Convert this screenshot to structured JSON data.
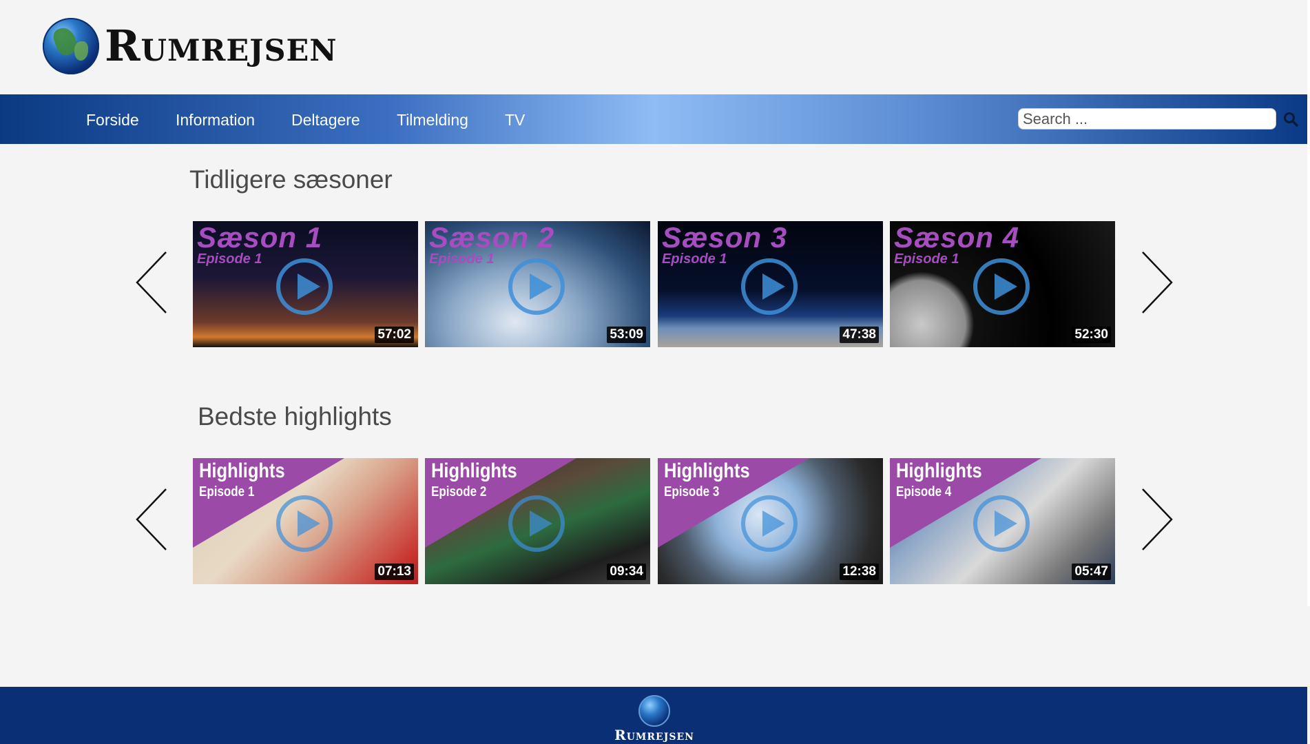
{
  "brand": {
    "name": "Rumrejsen"
  },
  "nav": {
    "items": [
      {
        "label": "Forside"
      },
      {
        "label": "Information"
      },
      {
        "label": "Deltagere"
      },
      {
        "label": "Tilmelding"
      },
      {
        "label": "TV"
      }
    ],
    "search_placeholder": "Search ..."
  },
  "seasons": {
    "title": "Tidligere sæsoner",
    "items": [
      {
        "title": "Sæson 1",
        "episode": "Episode 1",
        "duration": "57:02"
      },
      {
        "title": "Sæson 2",
        "episode": "Episode 1",
        "duration": "53:09"
      },
      {
        "title": "Sæson 3",
        "episode": "Episode 1",
        "duration": "47:38"
      },
      {
        "title": "Sæson 4",
        "episode": "Episode 1",
        "duration": "52:30"
      }
    ]
  },
  "highlights": {
    "title": "Bedste highlights",
    "items": [
      {
        "title": "Highlights",
        "episode": "Episode 1",
        "duration": "07:13"
      },
      {
        "title": "Highlights",
        "episode": "Episode 2",
        "duration": "09:34"
      },
      {
        "title": "Highlights",
        "episode": "Episode 3",
        "duration": "12:38"
      },
      {
        "title": "Highlights",
        "episode": "Episode 4",
        "duration": "05:47"
      }
    ]
  },
  "footer": {
    "brand": "Rumrejsen"
  },
  "colors": {
    "nav_dark": "#0b3a82",
    "nav_light": "#8fbcf4",
    "footer": "#0a2f74",
    "accent_purple": "#a64ec0"
  }
}
